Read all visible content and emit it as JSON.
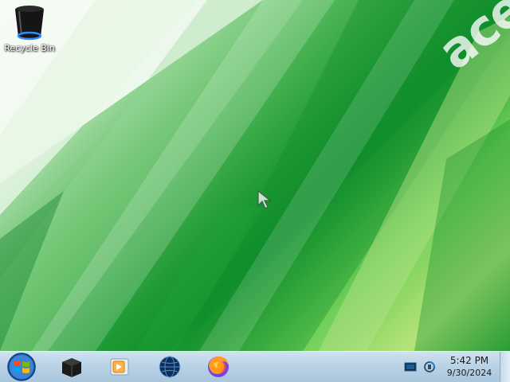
{
  "desktop": {
    "icons": [
      {
        "label": "Recycle Bin",
        "icon": "recycle-bin-icon"
      }
    ],
    "wallpaper_brand": "ace",
    "colors": {
      "wallpaper_dark": "#0f8f2b",
      "wallpaper_light": "#c9ecc1"
    }
  },
  "taskbar": {
    "start": {
      "icon": "windows-logo-icon"
    },
    "pinned": [
      {
        "name": "black-box-app",
        "icon": "black-box-icon"
      },
      {
        "name": "media-player",
        "icon": "media-player-icon"
      },
      {
        "name": "globe-app",
        "icon": "globe-icon"
      },
      {
        "name": "firefox",
        "icon": "firefox-icon"
      }
    ],
    "tray": {
      "icons": [
        "display-icon",
        "network-icon"
      ],
      "time": "5:42 PM",
      "date": "9/30/2024"
    }
  }
}
